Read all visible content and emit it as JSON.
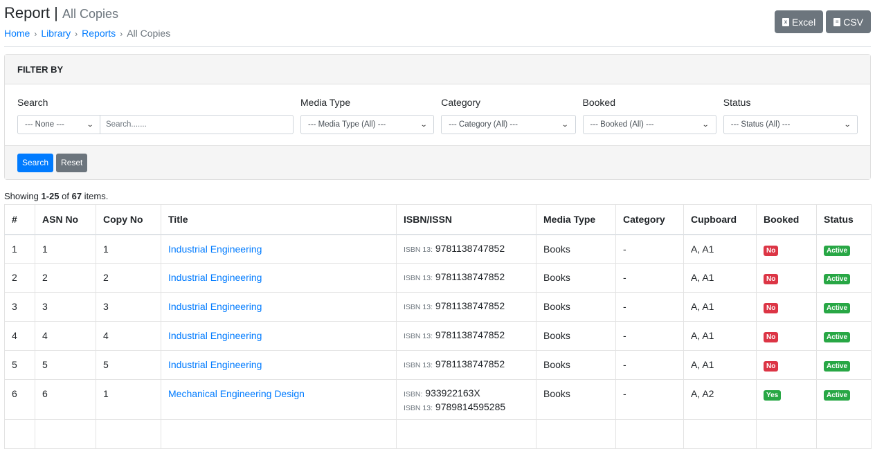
{
  "header": {
    "title": "Report",
    "separator": "|",
    "subtitle": "All Copies",
    "breadcrumb": [
      "Home",
      "Library",
      "Reports",
      "All Copies"
    ],
    "breadcrumb_sep": "›",
    "export_buttons": [
      {
        "label": "Excel",
        "icon": "file-excel-icon",
        "glyph": "x"
      },
      {
        "label": "CSV",
        "icon": "file-csv-icon",
        "glyph": "≡"
      }
    ]
  },
  "filter": {
    "title": "FILTER BY",
    "search": {
      "label": "Search",
      "field_select": "--- None ---",
      "placeholder": "Search......."
    },
    "media_type": {
      "label": "Media Type",
      "selected": "--- Media Type (All) ---"
    },
    "category": {
      "label": "Category",
      "selected": "--- Category (All) ---"
    },
    "booked": {
      "label": "Booked",
      "selected": "--- Booked (All) ---"
    },
    "status": {
      "label": "Status",
      "selected": "--- Status (All) ---"
    },
    "search_button": "Search",
    "reset_button": "Reset"
  },
  "summary": {
    "prefix": "Showing ",
    "range": "1-25",
    "of": " of ",
    "total": "67",
    "suffix": " items."
  },
  "table": {
    "columns": [
      "#",
      "ASN No",
      "Copy No",
      "Title",
      "ISBN/ISSN",
      "Media Type",
      "Category",
      "Cupboard",
      "Booked",
      "Status"
    ],
    "rows": [
      {
        "num": "1",
        "asn": "1",
        "copy": "1",
        "title": "Industrial Engineering",
        "isbn": [
          {
            "label": "ISBN 13:",
            "value": "9781138747852"
          }
        ],
        "media": "Books",
        "category": "-",
        "cupboard": "A, A1",
        "booked": "No",
        "status": "Active"
      },
      {
        "num": "2",
        "asn": "2",
        "copy": "2",
        "title": "Industrial Engineering",
        "isbn": [
          {
            "label": "ISBN 13:",
            "value": "9781138747852"
          }
        ],
        "media": "Books",
        "category": "-",
        "cupboard": "A, A1",
        "booked": "No",
        "status": "Active"
      },
      {
        "num": "3",
        "asn": "3",
        "copy": "3",
        "title": "Industrial Engineering",
        "isbn": [
          {
            "label": "ISBN 13:",
            "value": "9781138747852"
          }
        ],
        "media": "Books",
        "category": "-",
        "cupboard": "A, A1",
        "booked": "No",
        "status": "Active"
      },
      {
        "num": "4",
        "asn": "4",
        "copy": "4",
        "title": "Industrial Engineering",
        "isbn": [
          {
            "label": "ISBN 13:",
            "value": "9781138747852"
          }
        ],
        "media": "Books",
        "category": "-",
        "cupboard": "A, A1",
        "booked": "No",
        "status": "Active"
      },
      {
        "num": "5",
        "asn": "5",
        "copy": "5",
        "title": "Industrial Engineering",
        "isbn": [
          {
            "label": "ISBN 13:",
            "value": "9781138747852"
          }
        ],
        "media": "Books",
        "category": "-",
        "cupboard": "A, A1",
        "booked": "No",
        "status": "Active"
      },
      {
        "num": "6",
        "asn": "6",
        "copy": "1",
        "title": "Mechanical Engineering Design",
        "isbn": [
          {
            "label": "ISBN:",
            "value": "933922163X"
          },
          {
            "label": "ISBN 13:",
            "value": "9789814595285"
          }
        ],
        "media": "Books",
        "category": "-",
        "cupboard": "A, A2",
        "booked": "Yes",
        "status": "Active"
      }
    ]
  },
  "colors": {
    "primary": "#007bff",
    "secondary": "#6c757d",
    "danger": "#dc3545",
    "success": "#28a745"
  }
}
